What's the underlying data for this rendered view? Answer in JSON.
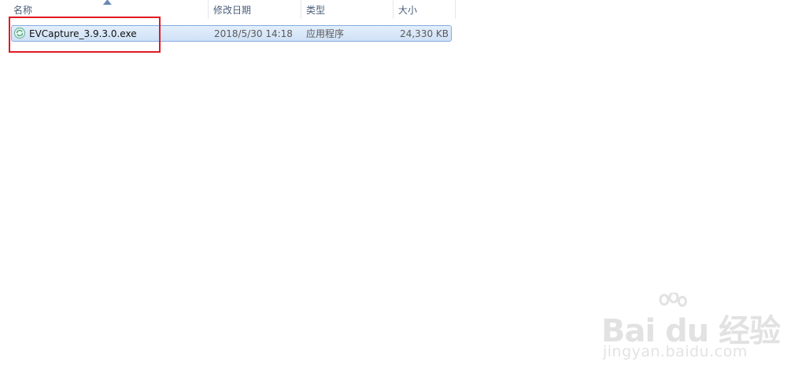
{
  "columns": {
    "name": "名称",
    "date_modified": "修改日期",
    "type": "类型",
    "size": "大小"
  },
  "files": [
    {
      "icon": "installer-exe-icon",
      "name": "EVCapture_3.9.3.0.exe",
      "date_modified": "2018/5/30 14:18",
      "type": "应用程序",
      "size": "24,330 KB",
      "selected": true
    }
  ],
  "watermark": {
    "logo_text": "Bai du 经验",
    "url": "jingyan.baidu.com"
  },
  "colors": {
    "highlight_box": "#e01b24",
    "selection_border": "#84acdd",
    "header_text": "#4c607a"
  }
}
